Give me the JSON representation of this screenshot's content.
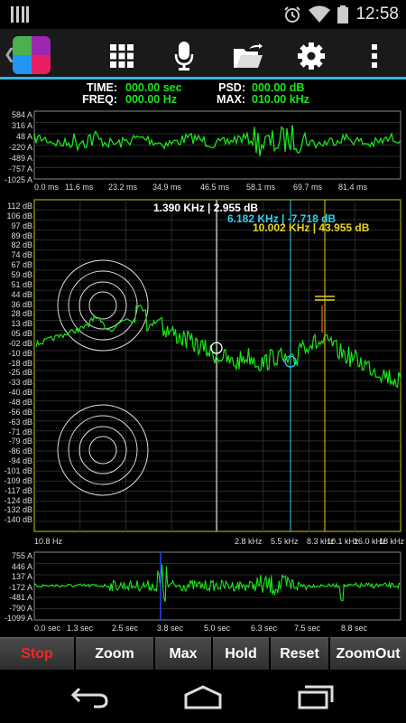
{
  "statusbar": {
    "time": "12:58"
  },
  "info": {
    "time_label": "TIME:",
    "time_value": "000.00 sec",
    "freq_label": "FREQ:",
    "freq_value": "000.00 Hz",
    "psd_label": "PSD:",
    "psd_value": "000.00 dB",
    "max_label": "MAX:",
    "max_value": "010.00 kHz"
  },
  "waveform": {
    "y_ticks": [
      "584 A",
      "316 A",
      "48 A",
      "-220 A",
      "-489 A",
      "-757 A",
      "-1025 A"
    ],
    "x_ticks": [
      "0.0 ms",
      "11.6 ms",
      "23.2 ms",
      "34.9 ms",
      "46.5 ms",
      "58.1 ms",
      "69.7 ms",
      "81.4 ms"
    ]
  },
  "spectrum": {
    "y_ticks": [
      "112 dB",
      "106 dB",
      "97 dB",
      "89 dB",
      "82 dB",
      "74 dB",
      "67 dB",
      "59 dB",
      "51 dB",
      "44 dB",
      "36 dB",
      "28 dB",
      "13 dB",
      "05 dB",
      "-02 dB",
      "-10 dB",
      "-18 dB",
      "-25 dB",
      "-33 dB",
      "-40 dB",
      "-48 dB",
      "-56 dB",
      "-63 dB",
      "-71 dB",
      "-79 dB",
      "-86 dB",
      "-94 dB",
      "-101 dB",
      "-109 dB",
      "-117 dB",
      "-124 dB",
      "-132 dB",
      "-140 dB"
    ],
    "x_ticks": [
      "10.8 Hz",
      "2.8 kHz",
      "5.5 kHz",
      "8.3 kHz",
      "10.1 kHz",
      "16.0 kHz",
      "18 kHz"
    ],
    "cursor_white": "1.390 KHz | 2.955 dB",
    "cursor_cyan": "6.182 KHz | -7.718 dB",
    "cursor_yellow": "10.002 KHz | 43.955 dB",
    "cursor_white_color": "#ffffff",
    "cursor_cyan_color": "#33ccee",
    "cursor_yellow_color": "#e6d21e"
  },
  "timeline": {
    "y_ticks": [
      "755 A",
      "446 A",
      "137 A",
      "-172 A",
      "-481 A",
      "-790 A",
      "-1099 A"
    ],
    "x_ticks": [
      "0.0 sec",
      "1.3 sec",
      "2.5 sec",
      "3.8 sec",
      "5.0 sec",
      "6.3 sec",
      "7.5 sec",
      "8.8 sec"
    ]
  },
  "buttons": {
    "stop": "Stop",
    "zoom": "Zoom",
    "max": "Max",
    "hold": "Hold",
    "reset": "Reset",
    "zoomout": "ZoomOut"
  },
  "colors": {
    "accent": "#33b5e5",
    "signal": "#19e619",
    "grid": "#2a2a2a",
    "stop": "#ff2222"
  },
  "icons": [
    "grid-menu-icon",
    "microphone-icon",
    "folder-share-icon",
    "gear-icon",
    "overflow-menu-icon",
    "back-nav-icon",
    "home-nav-icon",
    "recents-nav-icon"
  ]
}
